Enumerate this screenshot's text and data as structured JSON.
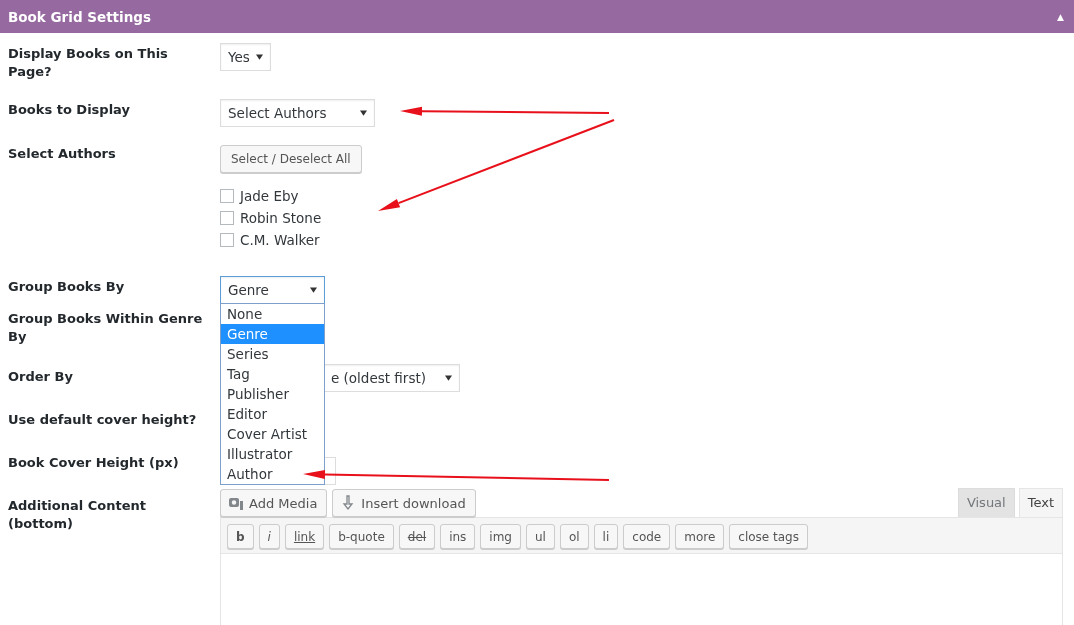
{
  "panel": {
    "title": "Book Grid Settings",
    "collapse_glyph": "▲"
  },
  "rows": [
    {
      "kind": "select",
      "label": "Display Books on This Page?",
      "value": "Yes"
    },
    {
      "kind": "select",
      "label": "Books to Display",
      "value": "Select Authors"
    },
    {
      "kind": "checklist",
      "label": "Select Authors",
      "button": "Select / Deselect All",
      "items": [
        {
          "label": "Jade Eby",
          "checked": false
        },
        {
          "label": "Robin Stone",
          "checked": false
        },
        {
          "label": "C.M. Walker",
          "checked": false
        }
      ]
    },
    {
      "kind": "dropdown",
      "label": "Group Books By",
      "value": "Genre",
      "options": [
        {
          "label": "None",
          "selected": false
        },
        {
          "label": "Genre",
          "selected": true
        },
        {
          "label": "Series",
          "selected": false
        },
        {
          "label": "Tag",
          "selected": false
        },
        {
          "label": "Publisher",
          "selected": false
        },
        {
          "label": "Editor",
          "selected": false
        },
        {
          "label": "Cover Artist",
          "selected": false
        },
        {
          "label": "Illustrator",
          "selected": false
        },
        {
          "label": "Author",
          "selected": false
        }
      ]
    },
    {
      "kind": "hidden",
      "label": "Group Books Within Genre By"
    },
    {
      "kind": "partial-select",
      "label": "Order By",
      "value": "e (oldest first)"
    },
    {
      "kind": "hidden",
      "label": "Use default cover height?"
    },
    {
      "kind": "input",
      "label": "Book Cover Height (px)"
    },
    {
      "kind": "editor",
      "label": "Additional Content (bottom)",
      "media_buttons": [
        "Add Media",
        "Insert download"
      ],
      "tabs": [
        {
          "label": "Visual",
          "selected": false
        },
        {
          "label": "Text",
          "selected": true
        }
      ],
      "quicktags": [
        "b",
        "i",
        "link",
        "b-quote",
        "del",
        "ins",
        "img",
        "ul",
        "ol",
        "li",
        "code",
        "more",
        "close tags"
      ]
    }
  ]
}
